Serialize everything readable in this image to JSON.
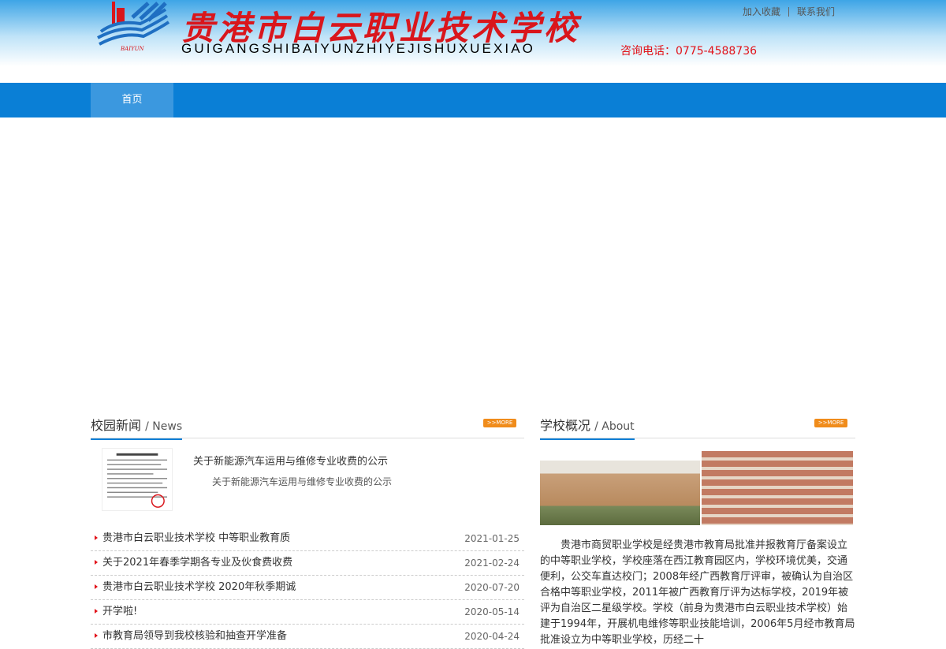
{
  "header": {
    "title_cn": "贵港市白云职业技术学校",
    "title_en": "GUIGANGSHIBAIYUNZHIYEJISHUXUEXIAO",
    "links": [
      "加入收藏",
      "联系我们"
    ],
    "phone_label": "咨询电话：0775-4588736"
  },
  "nav": {
    "items": [
      {
        "label": "首页"
      }
    ]
  },
  "news": {
    "title": "校园新闻",
    "title_en": "/ News",
    "more_label": ">>MORE",
    "feature": {
      "title": "关于新能源汽车运用与维修专业收费的公示",
      "desc": "关于新能源汽车运用与维修专业收费的公示"
    },
    "items": [
      {
        "title": "贵港市白云职业技术学校 中等职业教育质",
        "date": "2021-01-25"
      },
      {
        "title": "关于2021年春季学期各专业及伙食费收费",
        "date": "2021-02-24"
      },
      {
        "title": "贵港市白云职业技术学校 2020年秋季期诚",
        "date": "2020-07-20"
      },
      {
        "title": "开学啦!",
        "date": "2020-05-14"
      },
      {
        "title": "市教育局领导到我校核验和抽查开学准备",
        "date": "2020-04-24"
      }
    ]
  },
  "about": {
    "title": "学校概况",
    "title_en": "/ About",
    "more_label": ">>MORE",
    "text": "贵港市商贸职业学校是经贵港市教育局批准并报教育厅备案设立的中等职业学校，学校座落在西江教育园区内，学校环境优美，交通便利，公交车直达校门；2008年经广西教育厅评审，被确认为自治区合格中等职业学校，2011年被广西教育厅评为达标学校，2019年被评为自治区二星级学校。学校（前身为贵港市白云职业技术学校）始建于1994年，开展机电维修等职业技能培训，2006年5月经市教育局批准设立为中等职业学校，历经二十"
  },
  "colors": {
    "nav_bg": "#0a7fd6",
    "nav_active": "#3b98df",
    "title_red": "#d9161c",
    "more_orange": "#f08c1b"
  }
}
